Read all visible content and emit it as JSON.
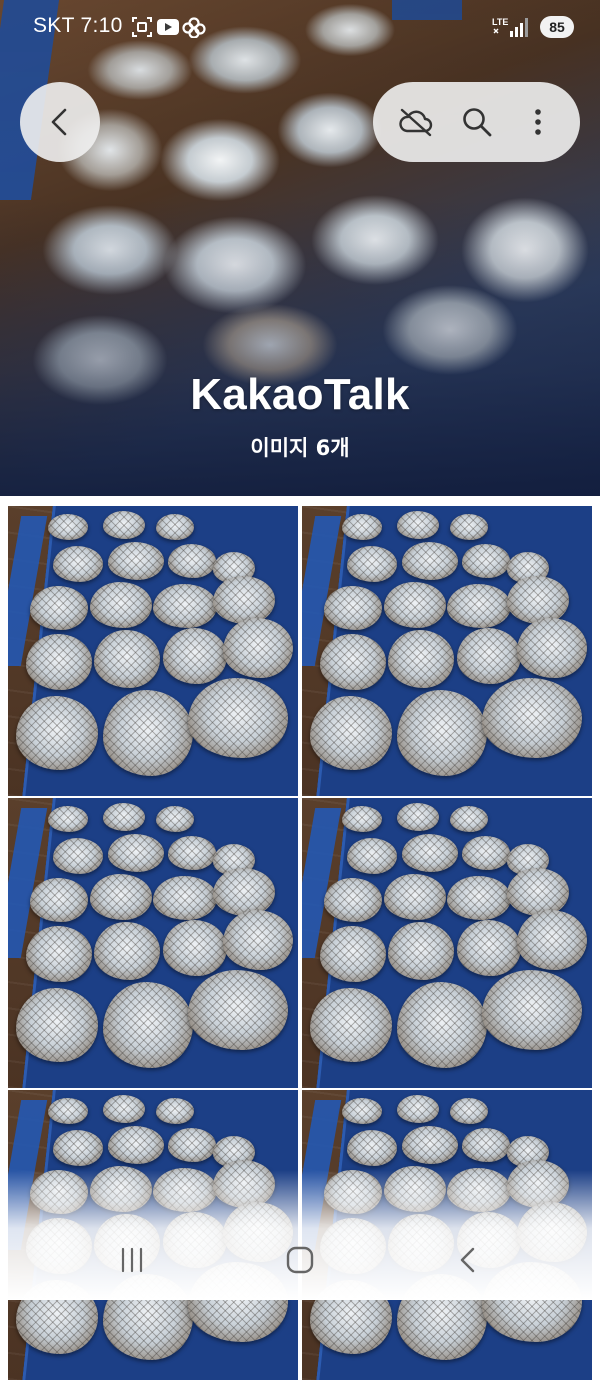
{
  "status_bar": {
    "carrier_time": "SKT 7:10",
    "network": "LTE",
    "battery": "85",
    "left_icons": [
      "screenshot-icon",
      "youtube-icon",
      "pinwheel-icon"
    ]
  },
  "toolbar": {
    "back_icon": "chevron-left-icon",
    "actions": [
      "cloud-off-icon",
      "search-icon",
      "more-vertical-icon"
    ]
  },
  "album": {
    "title": "KakaoTalk",
    "count": "이미지 6개"
  },
  "images": [
    {
      "index": 1,
      "subject": "net bags of squid on wooden deck"
    },
    {
      "index": 2,
      "subject": "net bags of squid on wooden deck"
    },
    {
      "index": 3,
      "subject": "net bags of squid on wooden deck"
    },
    {
      "index": 4,
      "subject": "net bags of squid on wooden deck"
    },
    {
      "index": 5,
      "subject": "net bags of squid on wooden deck"
    },
    {
      "index": 6,
      "subject": "net bags of squid on wooden deck"
    }
  ],
  "nav": [
    "recent-apps-icon",
    "home-icon",
    "back-icon"
  ],
  "colors": {
    "deck": "#5a3f2b",
    "mat": "#1c3f86",
    "pill": "#f0f0f0",
    "text_on_hero": "#ffffff"
  }
}
